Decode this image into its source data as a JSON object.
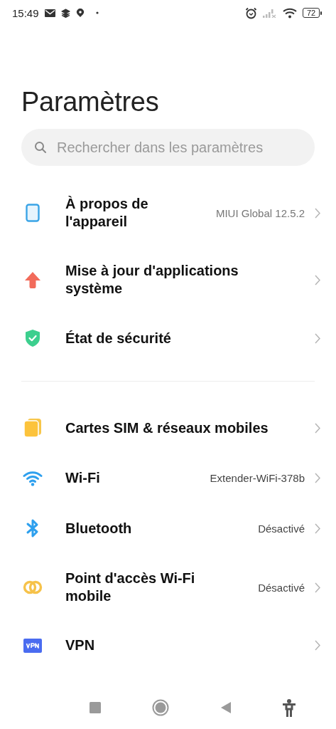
{
  "status_bar": {
    "time": "15:49",
    "battery": "72"
  },
  "title": "Paramètres",
  "search": {
    "placeholder": "Rechercher dans les paramètres"
  },
  "groups": [
    {
      "items": [
        {
          "kind": "phone",
          "label": "À propos de l'appareil",
          "value": "MIUI Global 12.5.2"
        },
        {
          "kind": "update",
          "label": "Mise à jour d'applications système"
        },
        {
          "kind": "shield",
          "label": "État de sécurité"
        }
      ]
    },
    {
      "items": [
        {
          "kind": "sim",
          "label": "Cartes SIM & réseaux mobiles"
        },
        {
          "kind": "wifi",
          "label": "Wi-Fi",
          "value": "Extender-WiFi-378b"
        },
        {
          "kind": "bluetooth",
          "label": "Bluetooth",
          "value": "Désactivé"
        },
        {
          "kind": "hotspot",
          "label": "Point d'accès Wi-Fi mobile",
          "value": "Désactivé"
        },
        {
          "kind": "vpn",
          "label": "VPN"
        }
      ]
    }
  ]
}
